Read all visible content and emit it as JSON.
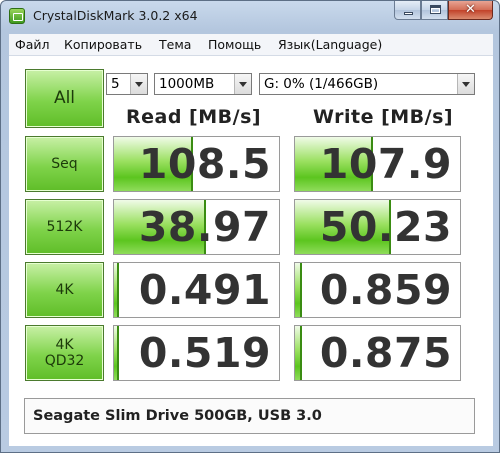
{
  "window": {
    "title": "CrystalDiskMark 3.0.2 x64",
    "close_glyph": "✕"
  },
  "menu": [
    "Файл",
    "Копировать",
    "Тема",
    "Помощь",
    "Язык(Language)"
  ],
  "controls": {
    "all_label": "All",
    "count": "5",
    "size": "1000MB",
    "drive": "G: 0% (1/466GB)"
  },
  "headers": {
    "read": "Read [MB/s]",
    "write": "Write [MB/s]"
  },
  "tests": [
    {
      "label_line1": "Seq",
      "label_line2": "",
      "read": "108.5",
      "write": "107.9",
      "read_fill": 0.48,
      "write_fill": 0.47
    },
    {
      "label_line1": "512K",
      "label_line2": "",
      "read": "38.97",
      "write": "50.23",
      "read_fill": 0.56,
      "write_fill": 0.58
    },
    {
      "label_line1": "4K",
      "label_line2": "",
      "read": "0.491",
      "write": "0.859",
      "read_fill": 0.03,
      "write_fill": 0.04
    },
    {
      "label_line1": "4K",
      "label_line2": "QD32",
      "read": "0.519",
      "write": "0.875",
      "read_fill": 0.03,
      "write_fill": 0.04
    }
  ],
  "comment": "Seagate Slim Drive 500GB, USB 3.0",
  "colors": {
    "accent_green": "#5cc51f",
    "frame_blue": "#b9cbe2",
    "close_red": "#c2422a"
  }
}
